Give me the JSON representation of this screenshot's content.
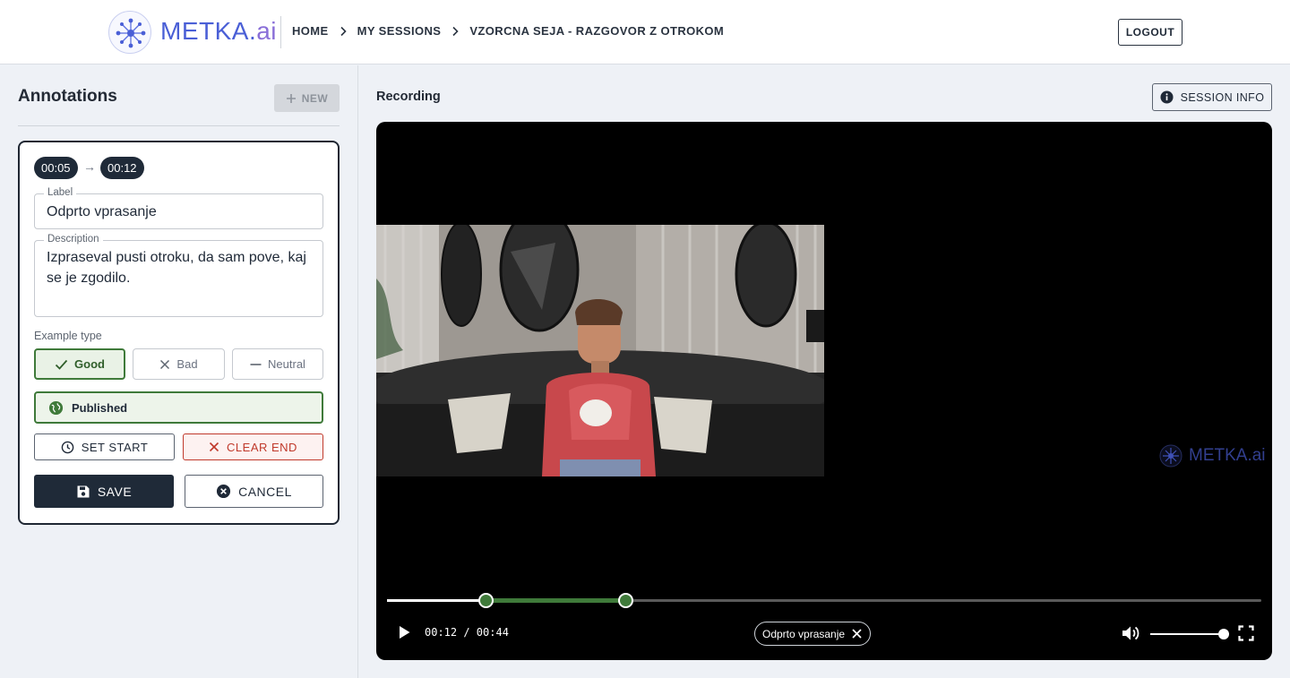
{
  "header": {
    "logo_main": "METKA.",
    "logo_suffix": "ai",
    "breadcrumbs": [
      "HOME",
      "MY SESSIONS",
      "VZORCNA SEJA - RAZGOVOR Z OTROKOM"
    ],
    "logout_label": "LOGOUT"
  },
  "annotations": {
    "title": "Annotations",
    "new_label": "NEW",
    "card": {
      "start": "00:05",
      "arrow": "→",
      "end": "00:12",
      "label_legend": "Label",
      "label_value": "Odprto vprasanje",
      "description_legend": "Description",
      "description_value": "Izpraseval pusti otroku, da sam pove, kaj se je zgodilo.",
      "example_type_label": "Example type",
      "example_types": [
        "Good",
        "Bad",
        "Neutral"
      ],
      "selected_example_type": "Good",
      "published_label": "Published",
      "set_start_label": "SET START",
      "clear_end_label": "CLEAR END",
      "save_label": "SAVE",
      "cancel_label": "CANCEL"
    }
  },
  "recording": {
    "title": "Recording",
    "session_info_label": "SESSION INFO",
    "watermark": "METKA.ai",
    "timecode": "00:12 / 00:44",
    "active_tag": "Odprto vprasanje",
    "progress": {
      "current_s": 12,
      "duration_s": 44,
      "range_start_s": 5,
      "range_end_s": 12
    },
    "volume": 1.0
  },
  "colors": {
    "accent_green": "#3f7a3a",
    "dark": "#1f2a38",
    "danger": "#c0392b",
    "brand_blue": "#4a5fd6"
  }
}
